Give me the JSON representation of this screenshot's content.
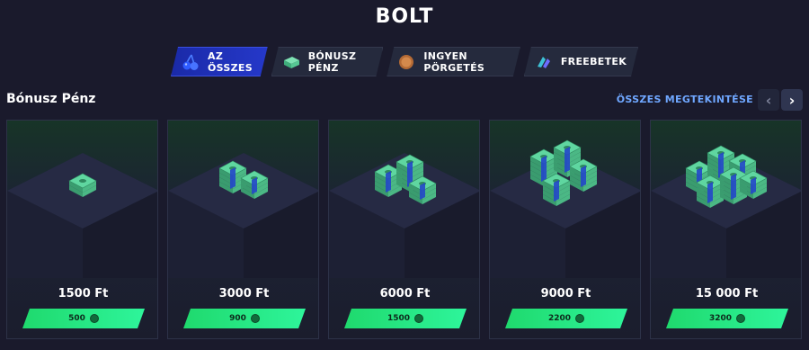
{
  "page": {
    "title": "BOLT"
  },
  "tabs": [
    {
      "label": "AZ ÖSSZES",
      "icon": "cherry-icon",
      "active": true
    },
    {
      "label": "BÓNUSZ PÉNZ",
      "icon": "money-stack-icon",
      "active": false
    },
    {
      "label": "INGYEN PÖRGETÉS",
      "icon": "coin-icon",
      "active": false
    },
    {
      "label": "FREEBETEK",
      "icon": "freebet-icon",
      "active": false
    }
  ],
  "section": {
    "title": "Bónusz Pénz",
    "see_all": "ÖSSZES MEGTEKINTÉSE",
    "prev": "‹",
    "next": "›"
  },
  "cards": [
    {
      "price": "1500 Ft",
      "cost": "500",
      "stacks": 1
    },
    {
      "price": "3000 Ft",
      "cost": "900",
      "stacks": 2
    },
    {
      "price": "6000 Ft",
      "cost": "1500",
      "stacks": 3
    },
    {
      "price": "9000 Ft",
      "cost": "2200",
      "stacks": 4
    },
    {
      "price": "15 000 Ft",
      "cost": "3200",
      "stacks": 6
    }
  ],
  "colors": {
    "accent": "#2538c9",
    "link": "#6fa7ff",
    "buy": "#2ef59b",
    "money": "#5fd6a0"
  }
}
